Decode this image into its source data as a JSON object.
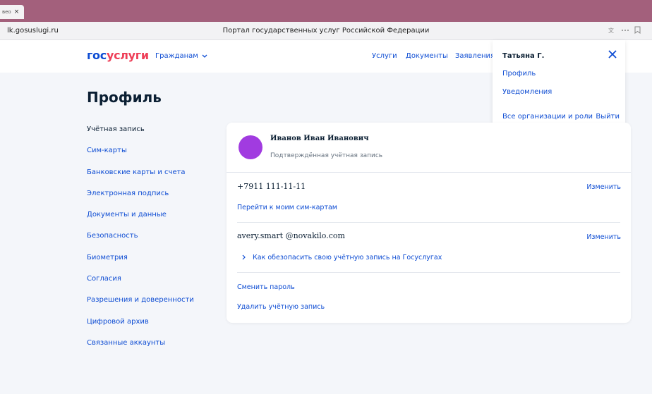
{
  "browser": {
    "tab_label": "вео",
    "tab_close": "×",
    "url": "lk.gosuslugi.ru",
    "page_title": "Портал государственных услуг Российской Федерации",
    "icons": [
      "translate-icon",
      "more-icon",
      "bookmark-icon"
    ]
  },
  "header": {
    "logo_part1": "гос",
    "logo_part2": "услуги",
    "audience_label": "Гражданам",
    "nav": [
      "Услуги",
      "Документы",
      "Заявления"
    ]
  },
  "user_menu": {
    "user_name": "Татьяна Г.",
    "items": [
      "Профиль",
      "Уведомления",
      "Все организации и роли"
    ],
    "logout": "Выйти"
  },
  "page": {
    "title": "Профиль"
  },
  "sidebar": {
    "items": [
      {
        "label": "Учётная запись",
        "active": true
      },
      {
        "label": "Сим-карты"
      },
      {
        "label": "Банковские карты и счета"
      },
      {
        "label": "Электронная подпись"
      },
      {
        "label": "Документы и данные"
      },
      {
        "label": "Безопасность"
      },
      {
        "label": "Биометрия"
      },
      {
        "label": "Согласия"
      },
      {
        "label": "Разрешения и доверенности"
      },
      {
        "label": "Цифровой архив"
      },
      {
        "label": "Связанные аккаунты"
      }
    ]
  },
  "account": {
    "full_name": "Иванов Иван Иванович",
    "status": "Подтверждённая учётная запись",
    "avatar_color": "#a13be0",
    "phone": "+7911 111-11-11",
    "phone_change": "Изменить",
    "sim_link": "Перейти к моим сим-картам",
    "email": "avery.smart @novakilo.com",
    "email_change": "Изменить",
    "secure_link": "Как обезопасить свою учётную запись на Госуслугах",
    "change_password": "Сменить пароль",
    "delete_account": "Удалить учётную запись"
  },
  "colors": {
    "link": "#0d4cd3",
    "accent_red": "#ee3f58",
    "tab_strip": "#a3607c",
    "background": "#f4f6fa"
  }
}
